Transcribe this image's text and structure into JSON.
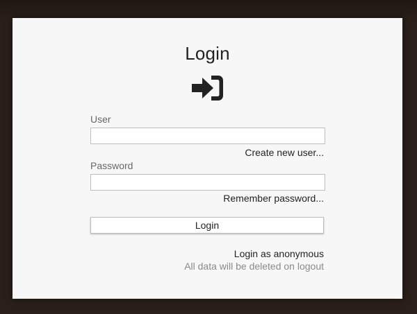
{
  "login_form": {
    "title": "Login",
    "icon": "sign-in-icon",
    "user_label": "User",
    "user_value": "",
    "create_user_link": "Create new user...",
    "password_label": "Password",
    "password_value": "",
    "remember_password_link": "Remember password...",
    "login_button": "Login",
    "anonymous_link": "Login as anonymous",
    "anonymous_note": "All data will be deleted on logout"
  },
  "colors": {
    "backdrop": "#2b2019",
    "panel": "#f7f7f7",
    "text": "#222222",
    "muted_text": "#8a8a8a"
  }
}
